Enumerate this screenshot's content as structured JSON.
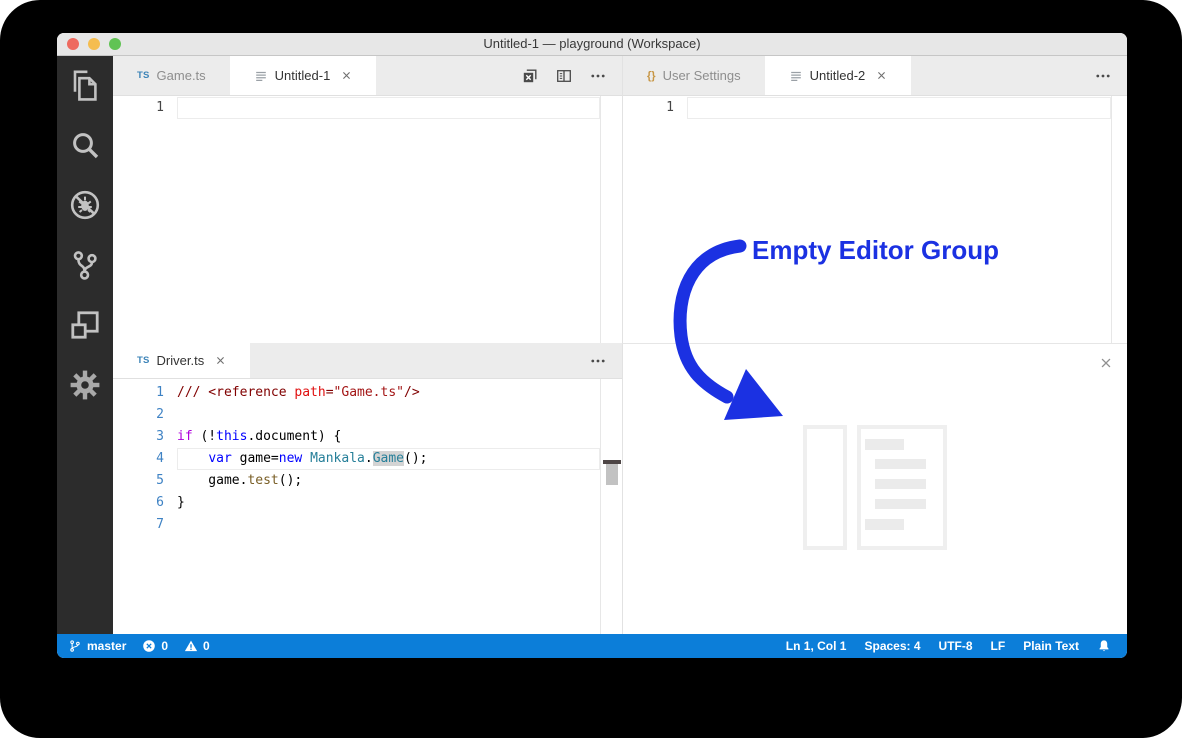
{
  "window": {
    "title": "Untitled-1 — playground (Workspace)",
    "traffic_lights": {
      "close": "#ee6a5f",
      "minimize": "#f5bd4f",
      "zoom": "#61c354"
    }
  },
  "activity_bar": {
    "top": [
      {
        "name": "explorer"
      },
      {
        "name": "search"
      },
      {
        "name": "debug-disabled"
      },
      {
        "name": "source-control"
      },
      {
        "name": "extensions"
      }
    ],
    "bottom": [
      {
        "name": "settings-gear"
      }
    ]
  },
  "editor_groups": {
    "top_left": {
      "tabs": [
        {
          "icon": "ts",
          "label": "Game.ts",
          "active": false,
          "closable": false
        },
        {
          "icon": "untitled",
          "label": "Untitled-1",
          "active": true,
          "closable": true
        }
      ],
      "actions": [
        "close-all-editors",
        "split-editor",
        "more-actions"
      ],
      "line_numbers": [
        "1"
      ]
    },
    "top_right": {
      "tabs": [
        {
          "icon": "braces",
          "label": "User Settings",
          "active": false,
          "closable": false
        },
        {
          "icon": "untitled",
          "label": "Untitled-2",
          "active": true,
          "closable": true
        }
      ],
      "actions": [
        "more-actions"
      ],
      "line_numbers": [
        "1"
      ]
    },
    "bottom_left": {
      "tabs": [
        {
          "icon": "ts",
          "label": "Driver.ts",
          "active": true,
          "closable": true
        }
      ],
      "actions": [
        "more-actions"
      ],
      "code": [
        {
          "n": "1",
          "tokens": [
            {
              "t": "/// <reference ",
              "c": "tag"
            },
            {
              "t": "path",
              "c": "attr"
            },
            {
              "t": "=",
              "c": "tag"
            },
            {
              "t": "\"Game.ts\"",
              "c": "string"
            },
            {
              "t": "/>",
              "c": "tag"
            }
          ]
        },
        {
          "n": "2",
          "tokens": []
        },
        {
          "n": "3",
          "tokens": [
            {
              "t": "if",
              "c": "kw1"
            },
            {
              "t": " (!",
              "c": "def"
            },
            {
              "t": "this",
              "c": "kw2"
            },
            {
              "t": ".document) {",
              "c": "def"
            }
          ]
        },
        {
          "n": "4",
          "current": true,
          "tokens": [
            {
              "t": "    ",
              "c": "def"
            },
            {
              "t": "var",
              "c": "kw2"
            },
            {
              "t": " game=",
              "c": "def"
            },
            {
              "t": "new",
              "c": "kw2"
            },
            {
              "t": " ",
              "c": "def"
            },
            {
              "t": "Mankala",
              "c": "cls"
            },
            {
              "t": ".",
              "c": "def"
            },
            {
              "t": "Game",
              "c": "cls",
              "hl": true
            },
            {
              "t": "();",
              "c": "def"
            }
          ]
        },
        {
          "n": "5",
          "tokens": [
            {
              "t": "    game.",
              "c": "def"
            },
            {
              "t": "test",
              "c": "fn"
            },
            {
              "t": "();",
              "c": "def"
            }
          ]
        },
        {
          "n": "6",
          "tokens": [
            {
              "t": "}",
              "c": "def"
            }
          ]
        },
        {
          "n": "7",
          "tokens": []
        }
      ]
    },
    "bottom_right": {
      "watermark": "empty-editor-group-watermark"
    }
  },
  "annotation": {
    "label": "Empty Editor Group",
    "color": "#1b31e2"
  },
  "status_bar": {
    "left": [
      {
        "icon": "git-branch",
        "label": "master"
      },
      {
        "icon": "error-circle",
        "label": "0"
      },
      {
        "icon": "warning-triangle",
        "label": "0"
      }
    ],
    "right": [
      {
        "label": "Ln 1, Col 1"
      },
      {
        "label": "Spaces: 4"
      },
      {
        "label": "UTF-8"
      },
      {
        "label": "LF"
      },
      {
        "label": "Plain Text"
      },
      {
        "icon": "bell"
      }
    ]
  },
  "colors": {
    "tag": "#800000",
    "attr": "#e01010",
    "string": "#a31515",
    "kw1": "#af00db",
    "kw2": "#0000ff",
    "cls": "#267f99",
    "fn": "#795e26",
    "def": "#000000",
    "line_number": "#3e82c4",
    "status_bar": "#0c7ed9",
    "annotation_blue": "#1b31e2"
  }
}
